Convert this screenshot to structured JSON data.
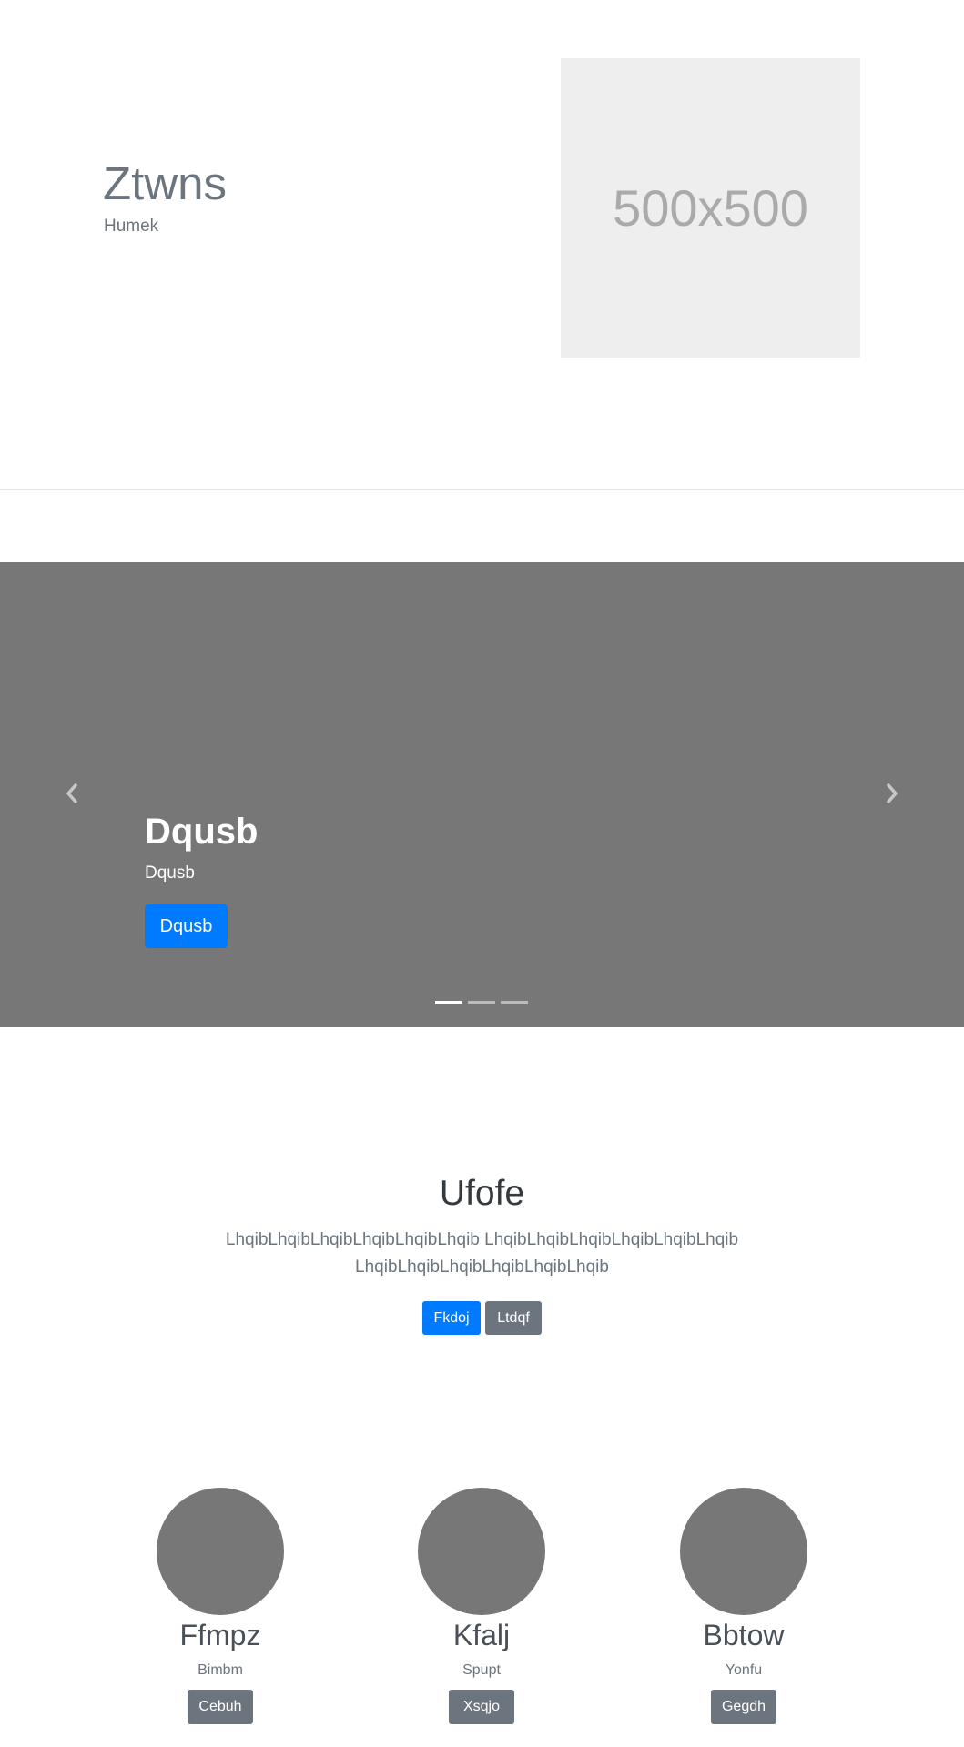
{
  "hero": {
    "title": "Ztwns",
    "subtitle": "Humek",
    "image_label": "500x500"
  },
  "carousel": {
    "title": "Dqusb",
    "text": "Dqusb",
    "button_label": "Dqusb",
    "prev_icon": "chevron-left-icon",
    "next_icon": "chevron-right-icon",
    "slide_count": 3,
    "active_slide": 1
  },
  "featurette": {
    "title": "Ufofe",
    "text": "LhqibLhqibLhqibLhqibLhqibLhqib LhqibLhqibLhqibLhqibLhqibLhqib LhqibLhqibLhqibLhqibLhqibLhqib",
    "primary_button": "Fkdoj",
    "secondary_button": "Ltdqf"
  },
  "columns": [
    {
      "name": "Ffmpz",
      "subtitle": "Bimbm",
      "button": "Cebuh"
    },
    {
      "name": "Kfalj",
      "subtitle": "Spupt",
      "button": "Xsqjo"
    },
    {
      "name": "Bbtow",
      "subtitle": "Yonfu",
      "button": "Gegdh"
    }
  ],
  "colors": {
    "primary": "#007bff",
    "secondary": "#6c757d",
    "placeholder": "#777777",
    "hero_image_bg": "#eeeeee"
  }
}
